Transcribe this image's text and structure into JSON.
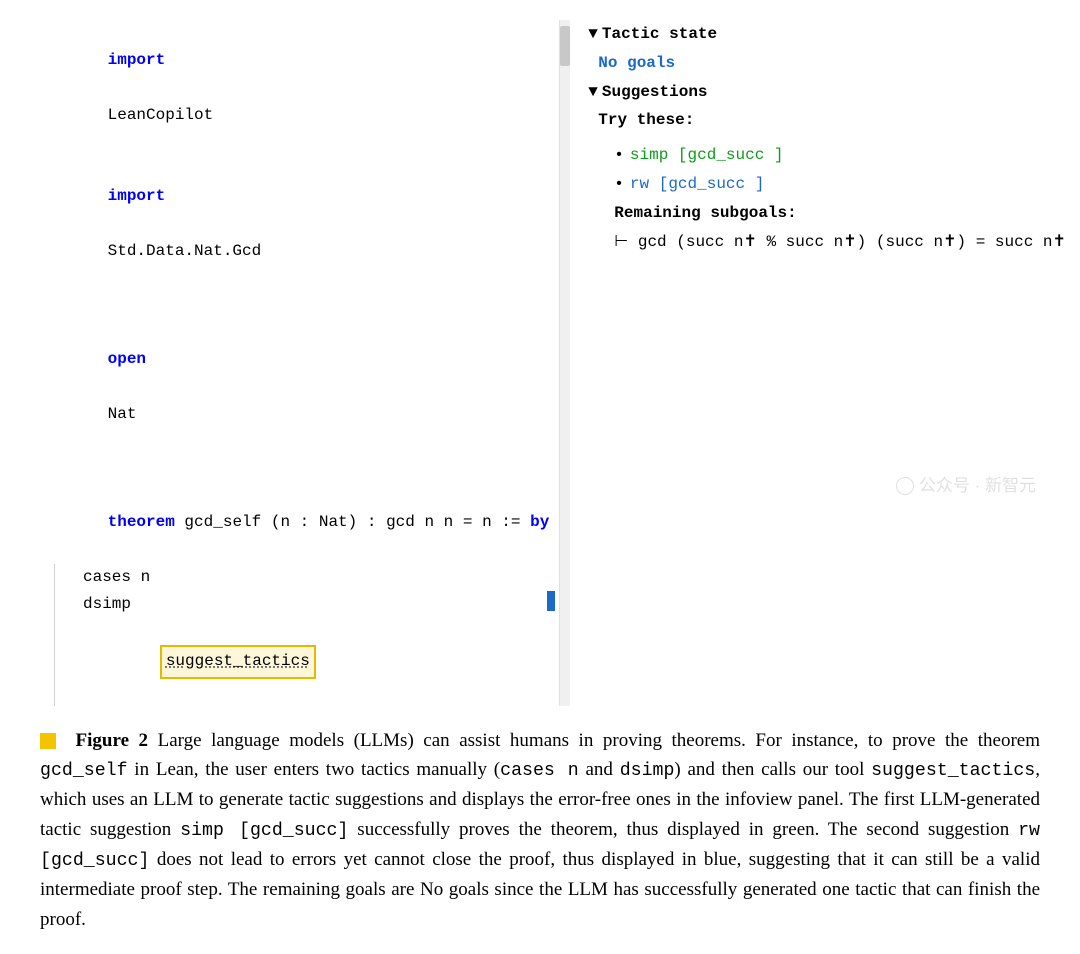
{
  "code": {
    "lines": {
      "l1_kw": "import",
      "l1_id": "LeanCopilot",
      "l2_kw": "import",
      "l2_id": "Std.Data.Nat.Gcd",
      "l3_kw": "open",
      "l3_id": "Nat",
      "l4_kw": "theorem",
      "l4_sig": " gcd_self (n : Nat) : gcd n n = n := ",
      "l4_by": "by",
      "l5": "cases n",
      "l6": "dsimp",
      "l7": "suggest_tactics"
    }
  },
  "info": {
    "tactic_state_header": "Tactic state",
    "no_goals": "No goals",
    "suggestions_header": "Suggestions",
    "try_these": "Try these:",
    "sugg1": "simp [gcd_succ ]",
    "sugg2": "rw [gcd_succ ]",
    "remaining_label": "Remaining subgoals:",
    "remaining_goal": "⊢ gcd (succ n✝ % succ n✝) (succ n✝) = succ n✝"
  },
  "caption": {
    "figure_label": "Figure 2",
    "t1": " Large language models (LLMs) can assist humans in proving theorems. For instance, to prove the theorem ",
    "c1": "gcd_self",
    "t2": " in Lean, the user enters two tactics manually (",
    "c2": "cases n",
    "t3": " and ",
    "c3": "dsimp",
    "t4": ") and then calls our tool ",
    "c4": "suggest_tactics",
    "t5": ", which uses an LLM to generate tactic suggestions and displays the error-free ones in the infoview panel. The first LLM-generated tactic suggestion ",
    "c5": "simp [gcd_succ]",
    "t6": " successfully proves the theorem, thus displayed in green. The second suggestion ",
    "c6": "rw [gcd_succ]",
    "t7": " does not lead to errors yet cannot close the proof, thus displayed in blue, suggesting that it can still be a valid intermediate proof step. The remaining goals are No goals since the LLM has successfully generated one tactic that can finish the proof."
  },
  "watermark": "公众号 · 新智元"
}
